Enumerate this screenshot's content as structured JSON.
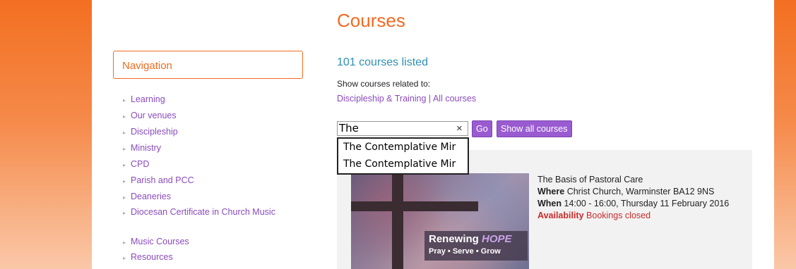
{
  "page": {
    "title": "Courses"
  },
  "navigation": {
    "title": "Navigation",
    "items": [
      {
        "label": "Learning"
      },
      {
        "label": "Our venues"
      },
      {
        "label": "Discipleship"
      },
      {
        "label": "Ministry"
      },
      {
        "label": "CPD"
      },
      {
        "label": "Parish and PCC"
      },
      {
        "label": "Deaneries"
      },
      {
        "label": "Diocesan Certificate in Church Music"
      },
      {
        "label": "Music Courses"
      },
      {
        "label": "Resources"
      }
    ]
  },
  "courses": {
    "count_text": "101 courses listed",
    "related_label": "Show courses related to:",
    "related_link_1": "Discipleship & Training",
    "separator": " | ",
    "related_link_2": "All courses"
  },
  "search": {
    "value": "The",
    "clear_symbol": "×",
    "go_label": "Go",
    "show_all_label": "Show all courses",
    "suggestions": [
      "The Contemplative Mir",
      "The Contemplative Mir"
    ]
  },
  "course_card": {
    "title": "The Basis of Pastoral Care",
    "where_label": "Where",
    "where_value": "Christ Church, Warminster BA12 9NS",
    "when_label": "When",
    "when_value": "14:00 - 16:00, Thursday 11 February 2016",
    "availability_label": "Availability",
    "availability_value": "Bookings closed",
    "image_text_1": "Renewing",
    "image_text_hope": "HOPE",
    "image_text_2": "Pray • Serve • Grow"
  },
  "colors": {
    "accent_orange": "#f26b21",
    "link_purple": "#8a4bbd",
    "button_purple": "#9a5bd1",
    "count_blue": "#2f8fb3",
    "closed_red": "#cc2a2a",
    "panel_grey": "#f2f2f2"
  }
}
